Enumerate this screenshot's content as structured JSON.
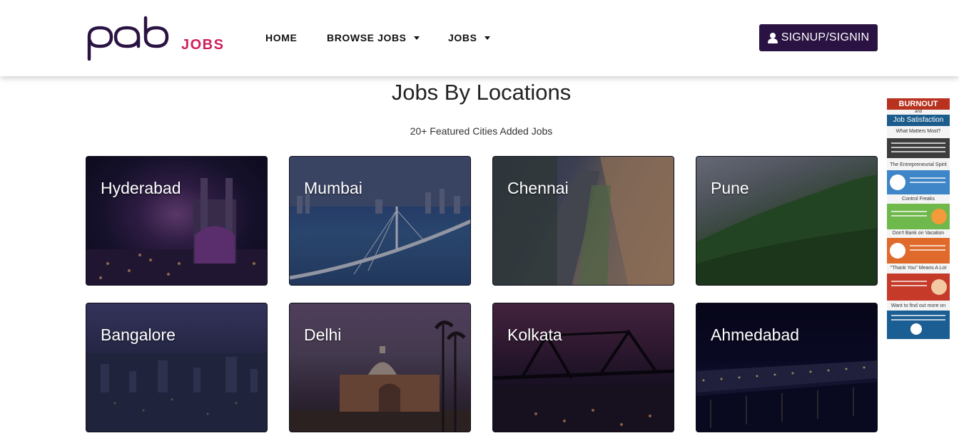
{
  "header": {
    "logo_text": "pab",
    "logo_suffix": "JOBS",
    "nav": {
      "home": "HOME",
      "browse_jobs": "BROWSE JOBS",
      "jobs": "JOBS"
    },
    "signup_label": "SIGNUP/SIGNIN"
  },
  "section": {
    "title": "Jobs By Locations",
    "subtitle": "20+ Featured Cities Added Jobs"
  },
  "cities": [
    {
      "name": "Hyderabad"
    },
    {
      "name": "Mumbai"
    },
    {
      "name": "Chennai"
    },
    {
      "name": "Pune"
    },
    {
      "name": "Bangalore"
    },
    {
      "name": "Delhi"
    },
    {
      "name": "Kolkata"
    },
    {
      "name": "Ahmedabad"
    }
  ],
  "ad": {
    "title_top": "BURNOUT",
    "title_and": "and",
    "title_bottom": "Job Satisfaction",
    "q1": "What Matters Most?",
    "s1": "The Entrepreneurial Spirit",
    "s2": "Control Freaks",
    "s3": "Don't Bank on Vacation",
    "s4": "\"Thank You\" Means A Lot",
    "s5": "Want to find out more on the survey?"
  },
  "colors": {
    "brand_dark": "#2a1342",
    "brand_pink": "#cf1f5d"
  }
}
